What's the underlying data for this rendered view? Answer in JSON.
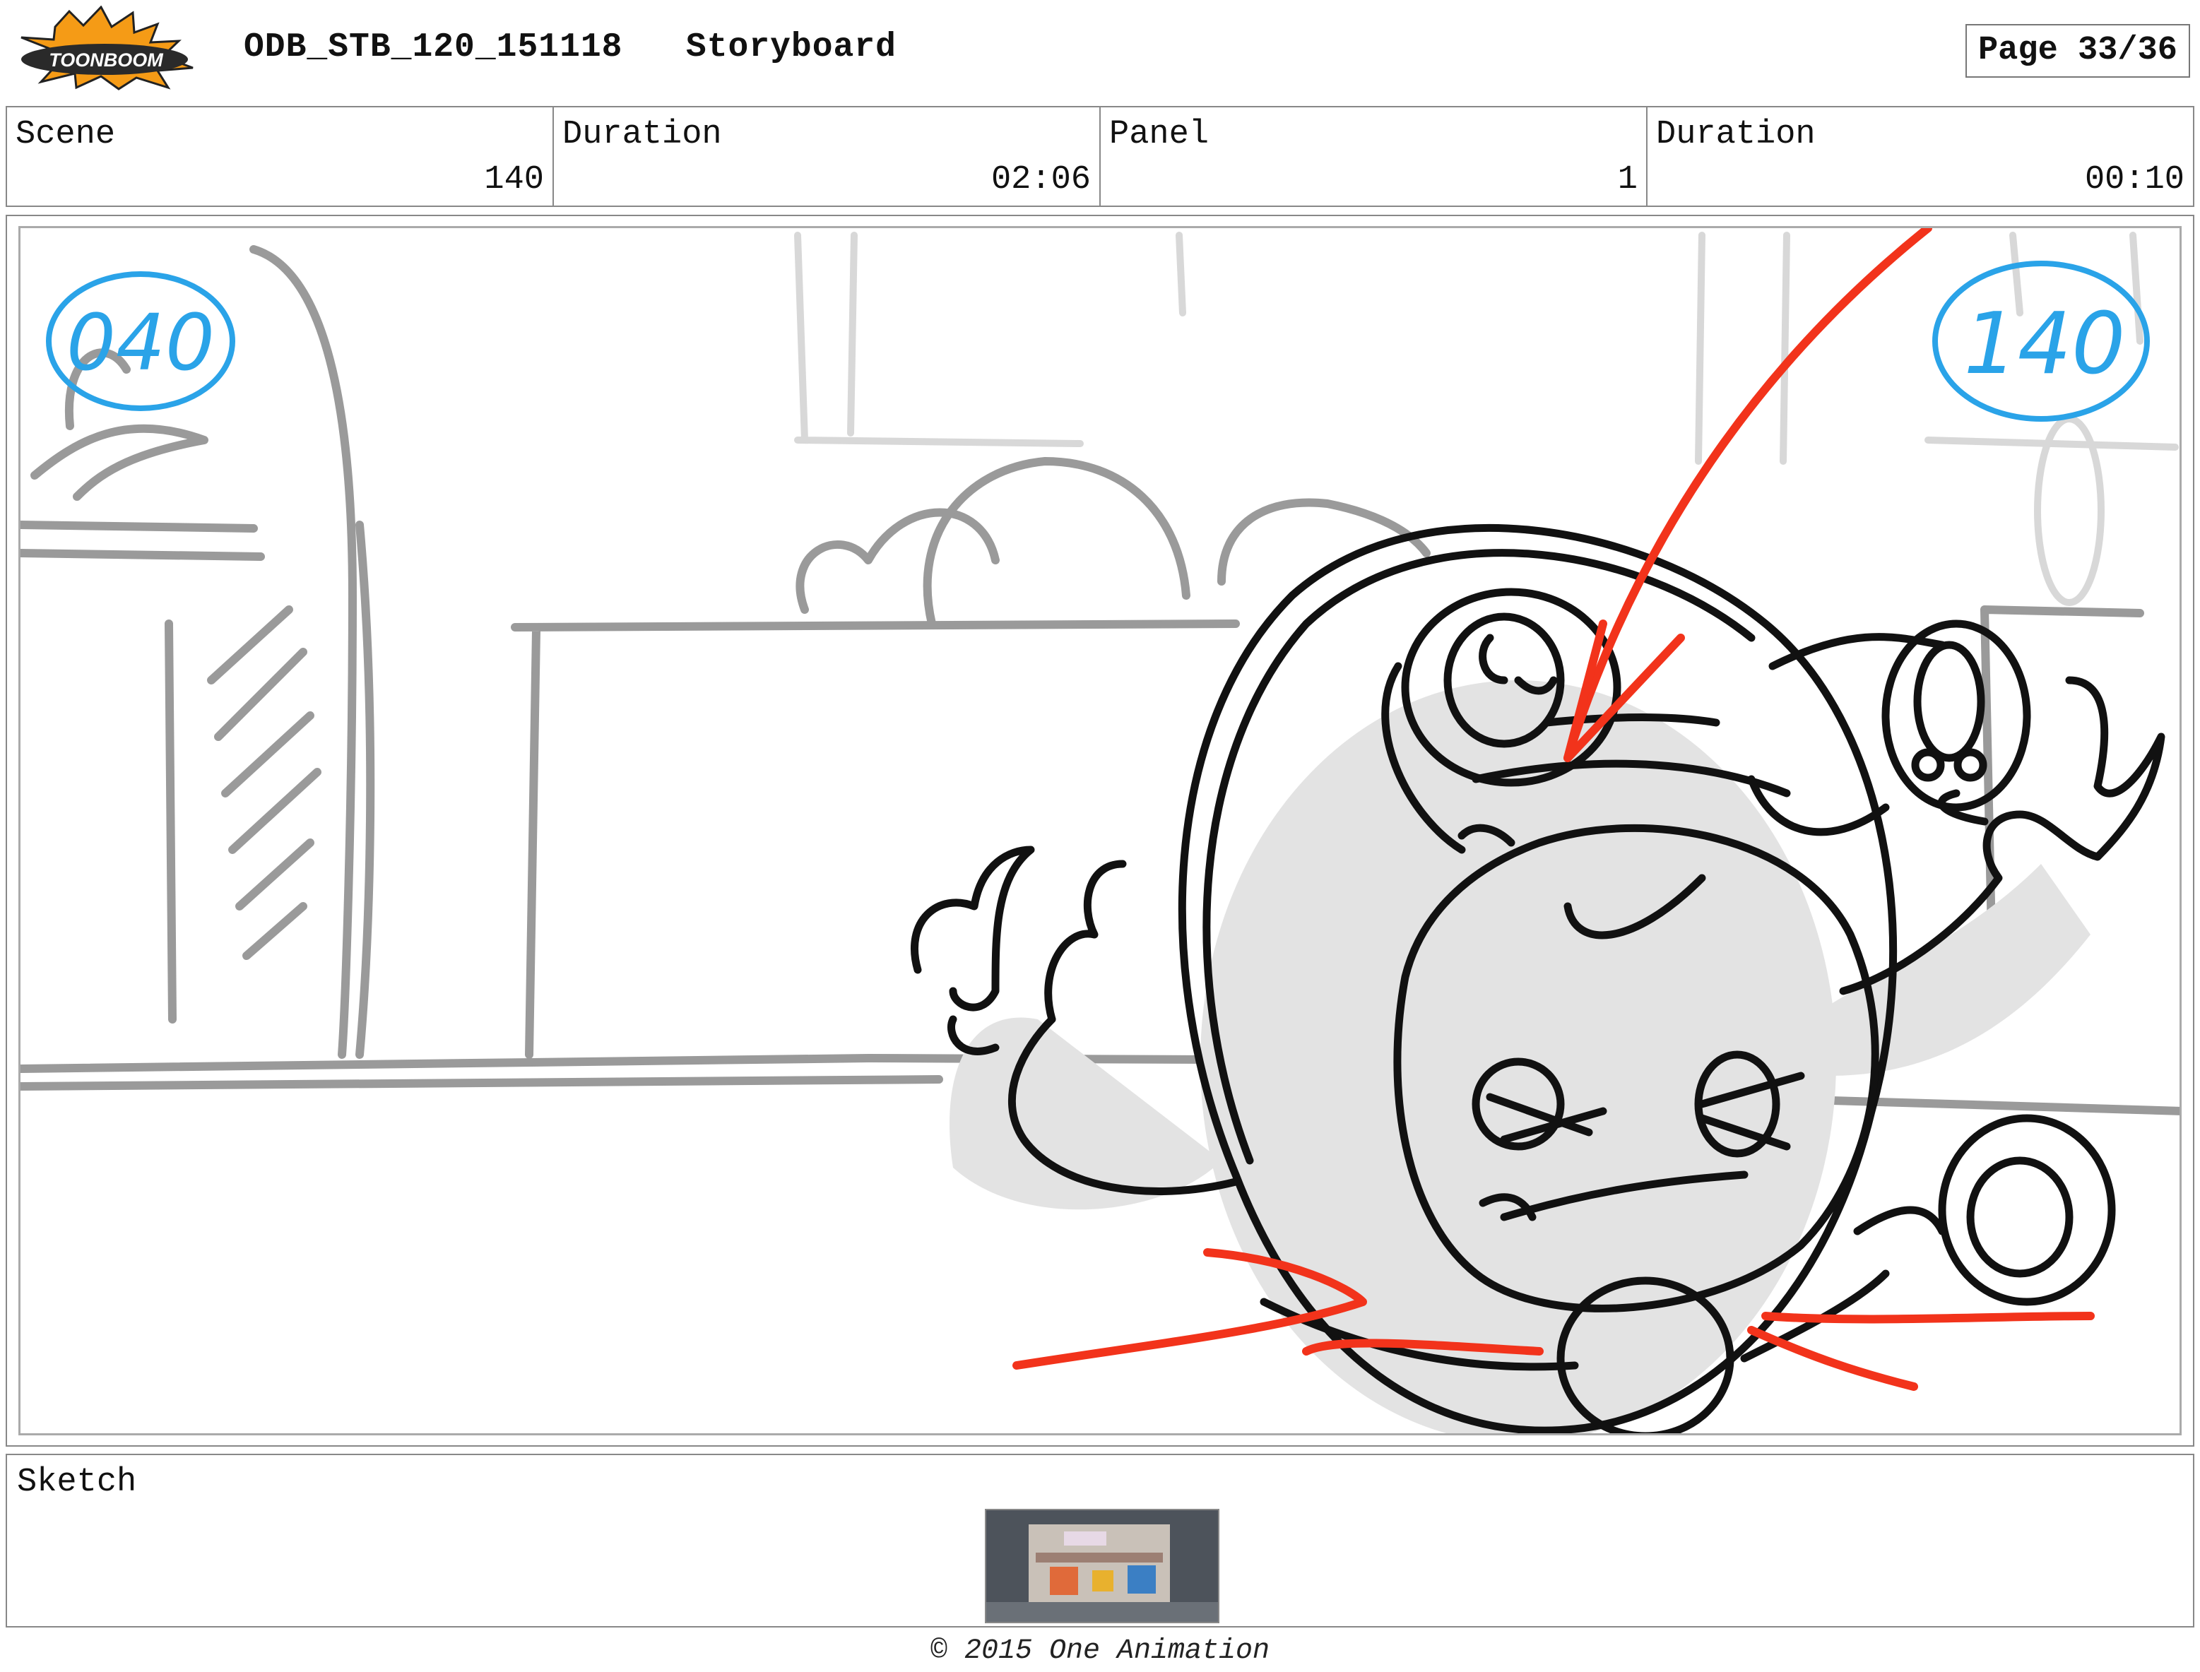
{
  "header": {
    "logo_text": "TOONBOOM",
    "title": "ODB_STB_120_151118   Storyboard",
    "page": "Page 33/36"
  },
  "info": {
    "scene_label": "Scene",
    "scene_value": "140",
    "scene_duration_label": "Duration",
    "scene_duration_value": "02:06",
    "panel_label": "Panel",
    "panel_value": "1",
    "panel_duration_label": "Duration",
    "panel_duration_value": "00:10"
  },
  "panel": {
    "annotation_left": "040",
    "annotation_right": "140",
    "colors": {
      "annotation_blue": "#2aa3e8",
      "arrow_red": "#f2331b",
      "line_black": "#111111",
      "bg_gray": "#9a9a9a",
      "fill_gray": "#e3e3e3"
    }
  },
  "sketch": {
    "label": "Sketch"
  },
  "footer": {
    "copyright": "© 2015 One Animation"
  }
}
